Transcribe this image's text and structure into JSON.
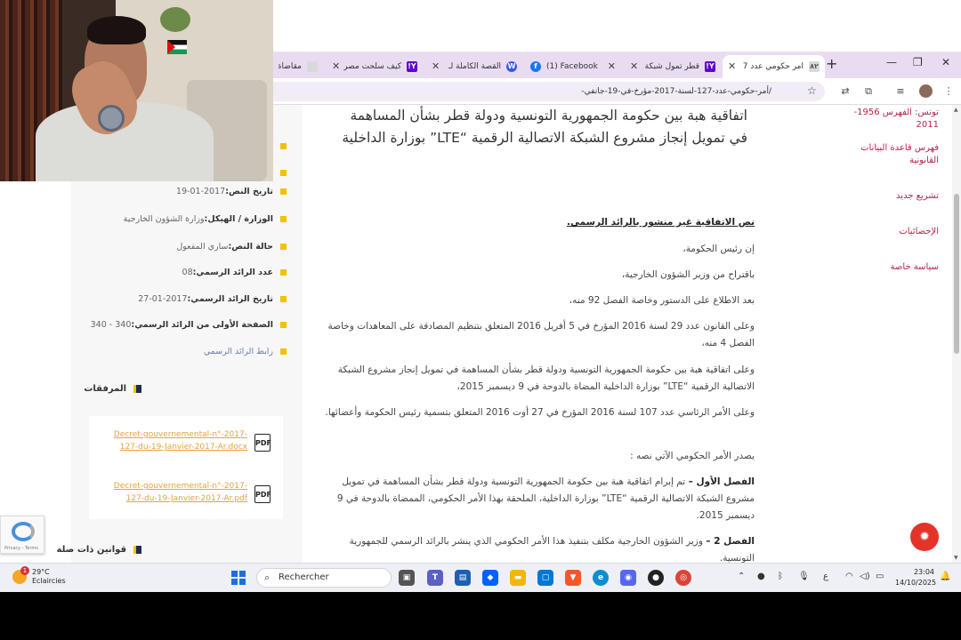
{
  "browser": {
    "tabs": [
      {
        "title": "أمر حكومي عدد 7",
        "active": true,
        "favicon": "doc-icon",
        "color": "#d9d9d9"
      },
      {
        "title": "قطر تمول شبكة",
        "active": false,
        "favicon": "yahoo-icon",
        "color": "#6001d2"
      },
      {
        "title": "(1) Facebook",
        "active": false,
        "favicon": "facebook-icon",
        "color": "#1877f2"
      },
      {
        "title": "القصة الكاملة لـ",
        "active": false,
        "favicon": "wordpress-icon",
        "color": "#3858e9"
      },
      {
        "title": "كيف سلحت مصر",
        "active": false,
        "favicon": "yahoo-icon",
        "color": "#6001d2"
      },
      {
        "title": "مقاضاة",
        "active": false,
        "favicon": "doc-icon",
        "color": "#d9d9d9"
      }
    ],
    "address": "/أمر-حكومي-عدد-127-لسنة-2017-مؤرخ-في-19-جانفي-"
  },
  "article": {
    "title": "اتفاقية هبة بين حكومة الجمهورية التونسية ودولة قطر بشأن المساهمة في تمويل إنجاز مشروع الشبكة الاتصالية الرقمية “LTE” بوزارة الداخلية",
    "notice": "نص الاتفاقية غير منشور بالرائد الرسمي.",
    "p1": "إن رئيس الحكومة،",
    "p2": "باقتراح من وزير الشؤون الخارجية،",
    "p3": "بعد الاطلاع على الدستور وخاصة الفصل 92 منه،",
    "p4": "وعلى القانون عدد 29 لسنة 2016 المؤرخ في 5 أفريل 2016 المتعلق بتنظيم المصادقة على المعاهدات وخاصة الفصل 4 منه،",
    "p5": "وعلى اتفاقية هبة بين حكومة الجمهورية التونسية ودولة قطر بشأن المساهمة في تمويل إنجاز مشروع الشبكة الاتصالية الرقمية “LTE” بوزارة الداخلية المضاة بالدوحة في 9 ديسمبر 2015،",
    "p6": "وعلى الأمر الرئاسي عدد 107 لسنة 2016 المؤرخ في 27 أوت 2016 المتعلق بتسمية رئيس الحكومة وأعضائها.",
    "p7": "يصدر الأمر الحكومي الآتي نصه :",
    "art1_label": "الفصل الأول –",
    "art1_text": "تم إبرام اتفاقية هبة بين حكومة الجمهورية التونسية ودولة قطر بشأن المساهمة في تمويل مشروع الشبكة الاتصالية الرقمية “LTE” بوزارة الداخلية، الملحقة بهذا الأمر الحكومي، الممضاة بالدوحة في 9 ديسمبر 2015.",
    "art2_label": "الفصل 2 –",
    "art2_text": "وزير الشؤون الخارجية مكلف بتنفيذ هذا الأمر الحكومي الذي ينشر بالرائد الرسمي للجمهورية التونسية."
  },
  "meta": [
    {
      "label": "تاريخ النص:",
      "value": "2017-01-19"
    },
    {
      "label": "الوزارة / الهيكل:",
      "value": "وزارة الشؤون الخارجية"
    },
    {
      "label": "حالة النص:",
      "value": "ساري المفعول"
    },
    {
      "label": "عدد الرائد الرسمي:",
      "value": "08"
    },
    {
      "label": "تاريخ الرائد الرسمي:",
      "value": "2017-01-27"
    },
    {
      "label": "الصفحة الأولى من الرائد الرسمي:",
      "value": "340 - 340"
    },
    {
      "label": "",
      "value": "رابط الرائد الرسمي"
    }
  ],
  "attachments": {
    "heading": "المرفقات",
    "files": [
      {
        "name": "Decret-gouvernemental-n°-2017-127-du-19-Janvier-2017-Ar.docx",
        "icon": "PDF"
      },
      {
        "name": "Decret-gouvernemental-n°-2017-127-du-19-Janvier-2017-Ar.pdf",
        "icon": "PDF"
      }
    ]
  },
  "related": {
    "heading": "قوانين ذات صلة"
  },
  "rightnav": [
    "تونس: الفهرس 1956-2011",
    "فهرس قاعدة البيانات القانونية",
    "تشريع جديد",
    "الإحصائيات",
    "سياسة خاصة"
  ],
  "recaptcha": {
    "text": "Privacy - Terms"
  },
  "taskbar": {
    "temperature": "29°C",
    "weather": "Eclaircies",
    "weather_badge": "1",
    "search_placeholder": "Rechercher",
    "time": "23:04",
    "date": "14/10/2025",
    "lang": "ع"
  },
  "colors": {
    "accent": "#b5254a",
    "bullet": "#f2c200",
    "link": "#e3a33a",
    "tabstrip": "#e9dcf1"
  }
}
